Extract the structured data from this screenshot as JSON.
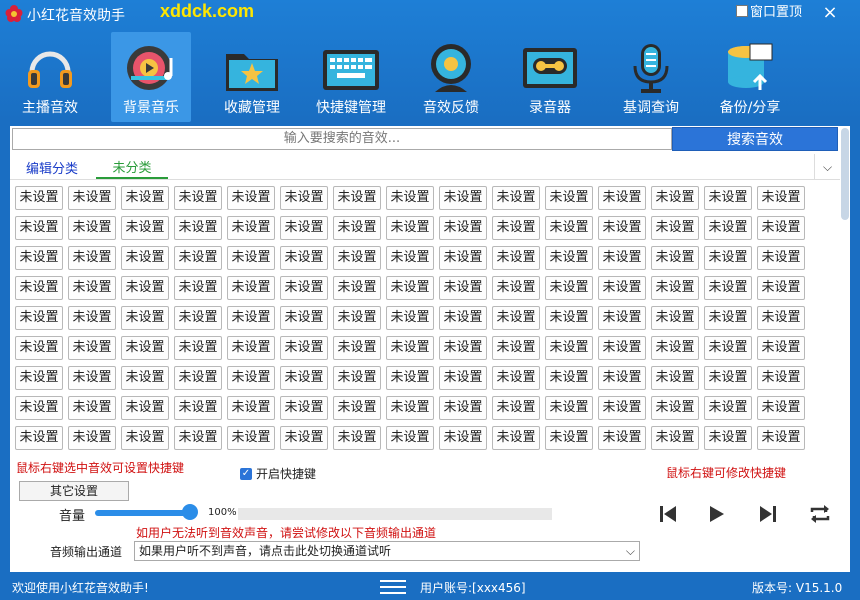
{
  "title": "小红花音效助手",
  "watermark": "xddck.com",
  "window": {
    "pin_label": "窗口置顶",
    "close": "×"
  },
  "toolbar": [
    {
      "label": "主播音效",
      "icon": "headphones-icon",
      "active": false
    },
    {
      "label": "背景音乐",
      "icon": "music-disc-icon",
      "active": true
    },
    {
      "label": "收藏管理",
      "icon": "star-folder-icon",
      "active": false
    },
    {
      "label": "快捷键管理",
      "icon": "keyboard-icon",
      "active": false
    },
    {
      "label": "音效反馈",
      "icon": "webcam-icon",
      "active": false
    },
    {
      "label": "录音器",
      "icon": "cassette-icon",
      "active": false
    },
    {
      "label": "基调查询",
      "icon": "microphone-icon",
      "active": false
    },
    {
      "label": "备份/分享",
      "icon": "database-upload-icon",
      "active": false
    }
  ],
  "search": {
    "placeholder": "输入要搜索的音效...",
    "button": "搜索音效"
  },
  "tabs": {
    "edit": "编辑分类",
    "current": "未分类"
  },
  "slot_label": "未设置",
  "grid": {
    "rows": 9,
    "cols": 15
  },
  "hints": {
    "left": "鼠标右键选中音效可设置快捷键",
    "right": "鼠标右键可修改快捷键",
    "hotkey_toggle": "开启快捷键",
    "warn": "如用户无法听到音效声音，请尝试修改以下音频输出通道"
  },
  "other_settings": "其它设置",
  "volume": {
    "label": "音量",
    "value_text": "100%",
    "level": 1.0
  },
  "output": {
    "label": "音频输出通道",
    "value": "如果用户听不到声音，请点击此处切换通道试听"
  },
  "status": {
    "welcome": "欢迎使用小红花音效助手!",
    "user": "用户账号:[xxx456]",
    "version": "版本号: V15.1.0"
  },
  "colors": {
    "accent": "#1a6ec2",
    "active_tab": "#3b97e6",
    "hint_red": "#d01010",
    "tab_green": "#2a9c3a"
  }
}
